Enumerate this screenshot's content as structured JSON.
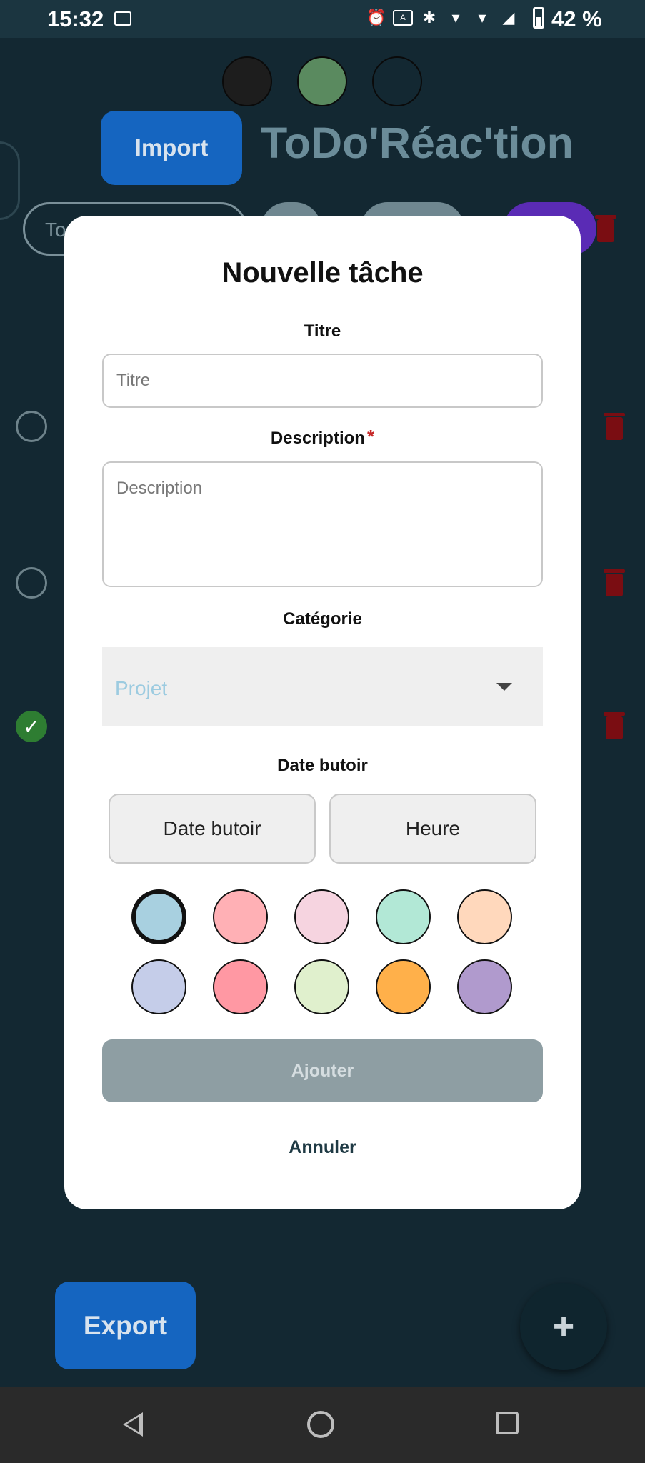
{
  "status_bar": {
    "time": "15:32",
    "battery_percent": "42 %",
    "icons": [
      "alarm-icon",
      "auto-brightness-icon",
      "bluetooth-icon",
      "wifi-6-icon",
      "wifi-6-icon",
      "cell-signal-icon",
      "battery-icon"
    ]
  },
  "app": {
    "title": "ToDo'Réac'tion",
    "import_label": "Import",
    "export_label": "Export",
    "fab_label": "+",
    "filter_all_label": "To",
    "theme_colors": [
      "#1d1d1d",
      "#5a8a5f",
      "#132832"
    ]
  },
  "modal": {
    "title": "Nouvelle tâche",
    "title_label": "Titre",
    "title_placeholder": "Titre",
    "description_label": "Description",
    "description_required": "*",
    "description_placeholder": "Description",
    "category_label": "Catégorie",
    "category_value": "Projet",
    "deadline_label": "Date butoir",
    "date_button": "Date butoir",
    "time_button": "Heure",
    "colors": [
      "#a8d0e0",
      "#ffb0b5",
      "#f6d4e0",
      "#b2e8d6",
      "#ffd8bc",
      "#c5cde9",
      "#ff98a3",
      "#e0f0cd",
      "#ffb04a",
      "#b09acd"
    ],
    "selected_color_index": 0,
    "add_button": "Ajouter",
    "cancel_button": "Annuler"
  }
}
